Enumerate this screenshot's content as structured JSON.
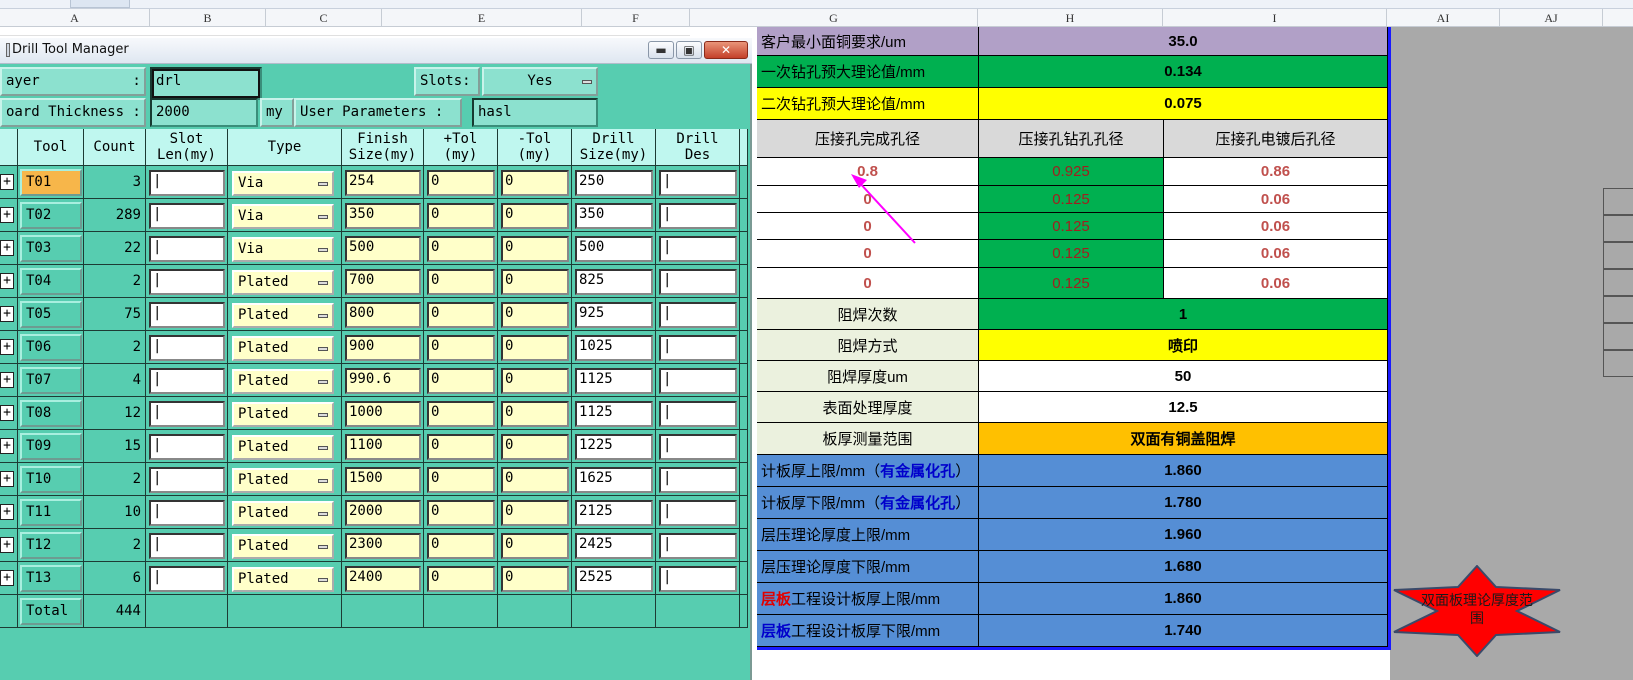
{
  "spreadsheet": {
    "columns": {
      "a": "A",
      "b": "B",
      "c": "C",
      "e": "E",
      "f": "F",
      "g": "G",
      "h": "H",
      "i": "I",
      "ai": "AI",
      "aj": "AJ"
    },
    "rows": {
      "r1": {
        "label": "客户最小面铜要求/um",
        "value": "35.0"
      },
      "r2": {
        "label": "一次钻孔预大理论值/mm",
        "value": "0.134"
      },
      "r3": {
        "label": "二次钻孔预大理论值/mm",
        "value": "0.075"
      },
      "hdr": {
        "g": "压接孔完成孔径",
        "h": "压接孔钻孔孔径",
        "i": "压接孔电镀后孔径"
      },
      "press": [
        {
          "g": "0.8",
          "h": "0.925",
          "i": "0.86"
        },
        {
          "g": "0",
          "h": "0.125",
          "i": "0.06"
        },
        {
          "g": "0",
          "h": "0.125",
          "i": "0.06"
        },
        {
          "g": "0",
          "h": "0.125",
          "i": "0.06"
        },
        {
          "g": "0",
          "h": "0.125",
          "i": "0.06"
        }
      ],
      "r10": {
        "label": "阻焊次数",
        "value": "1"
      },
      "r11": {
        "label": "阻焊方式",
        "value": "喷印"
      },
      "r12": {
        "label": "阻焊厚度um",
        "value": "50"
      },
      "r13": {
        "label": "表面处理厚度",
        "value": "12.5"
      },
      "r14": {
        "label": "板厚测量范围",
        "value": "双面有铜盖阻焊"
      },
      "r15": {
        "label_pre": "计板厚上限/mm（",
        "label_hl": "有金属化孔",
        "label_post": "）",
        "value": "1.860"
      },
      "r16": {
        "label_pre": "计板厚下限/mm（",
        "label_hl": "有金属化孔",
        "label_post": "）",
        "value": "1.780"
      },
      "r17": {
        "label": "层压理论厚度上限/mm",
        "value": "1.960"
      },
      "r18": {
        "label": "层压理论厚度下限/mm",
        "value": "1.680"
      },
      "r19": {
        "label_hl": "层板",
        "label_post": "工程设计板厚上限/mm",
        "value": "1.860"
      },
      "r20": {
        "label_hl": "层板",
        "label_post": "工程设计板厚下限/mm",
        "value": "1.740"
      }
    },
    "star_text": "双面板理论厚度范围",
    "colors": {
      "purple": "#b1a0c7",
      "green": "#00b050",
      "yellow": "#ffff00",
      "orange": "#ffc000",
      "blue": "#558ed5",
      "pale": "#ebf1de",
      "grey": "#d9d9d9",
      "star": "#ff0000"
    }
  },
  "dialog": {
    "title": "Drill Tool Manager",
    "controls": {
      "minimize": "▬",
      "maximize": "▣",
      "close": "✕"
    },
    "layer_label": "ayer           :",
    "layer_value": "drl",
    "slots_label": "Slots:",
    "slots_value": "Yes",
    "thickness_label": "oard Thickness :",
    "thickness_value": "2000",
    "thickness_unit": "my",
    "user_params_label": "User Parameters :",
    "user_params_value": "hasl",
    "headers": [
      "Tool",
      "Count",
      "Slot\nLen(my)",
      "Type",
      "Finish\nSize(my)",
      "+Tol\n(my)",
      "-Tol\n(my)",
      "Drill\nSize(my)",
      "Drill\nDes"
    ],
    "tools": [
      {
        "tool": "T01",
        "count": "3",
        "type": "Via",
        "finish": "254",
        "ptol": "0",
        "ntol": "0",
        "drill": "250"
      },
      {
        "tool": "T02",
        "count": "289",
        "type": "Via",
        "finish": "350",
        "ptol": "0",
        "ntol": "0",
        "drill": "350"
      },
      {
        "tool": "T03",
        "count": "22",
        "type": "Via",
        "finish": "500",
        "ptol": "0",
        "ntol": "0",
        "drill": "500"
      },
      {
        "tool": "T04",
        "count": "2",
        "type": "Plated",
        "finish": "700",
        "ptol": "0",
        "ntol": "0",
        "drill": "825"
      },
      {
        "tool": "T05",
        "count": "75",
        "type": "Plated",
        "finish": "800",
        "ptol": "0",
        "ntol": "0",
        "drill": "925"
      },
      {
        "tool": "T06",
        "count": "2",
        "type": "Plated",
        "finish": "900",
        "ptol": "0",
        "ntol": "0",
        "drill": "1025"
      },
      {
        "tool": "T07",
        "count": "4",
        "type": "Plated",
        "finish": "990.6",
        "ptol": "0",
        "ntol": "0",
        "drill": "1125"
      },
      {
        "tool": "T08",
        "count": "12",
        "type": "Plated",
        "finish": "1000",
        "ptol": "0",
        "ntol": "0",
        "drill": "1125"
      },
      {
        "tool": "T09",
        "count": "15",
        "type": "Plated",
        "finish": "1100",
        "ptol": "0",
        "ntol": "0",
        "drill": "1225"
      },
      {
        "tool": "T10",
        "count": "2",
        "type": "Plated",
        "finish": "1500",
        "ptol": "0",
        "ntol": "0",
        "drill": "1625"
      },
      {
        "tool": "T11",
        "count": "10",
        "type": "Plated",
        "finish": "2000",
        "ptol": "0",
        "ntol": "0",
        "drill": "2125"
      },
      {
        "tool": "T12",
        "count": "2",
        "type": "Plated",
        "finish": "2300",
        "ptol": "0",
        "ntol": "0",
        "drill": "2425"
      },
      {
        "tool": "T13",
        "count": "6",
        "type": "Plated",
        "finish": "2400",
        "ptol": "0",
        "ntol": "0",
        "drill": "2525"
      }
    ],
    "total_label": "Total",
    "total_count": "444"
  }
}
